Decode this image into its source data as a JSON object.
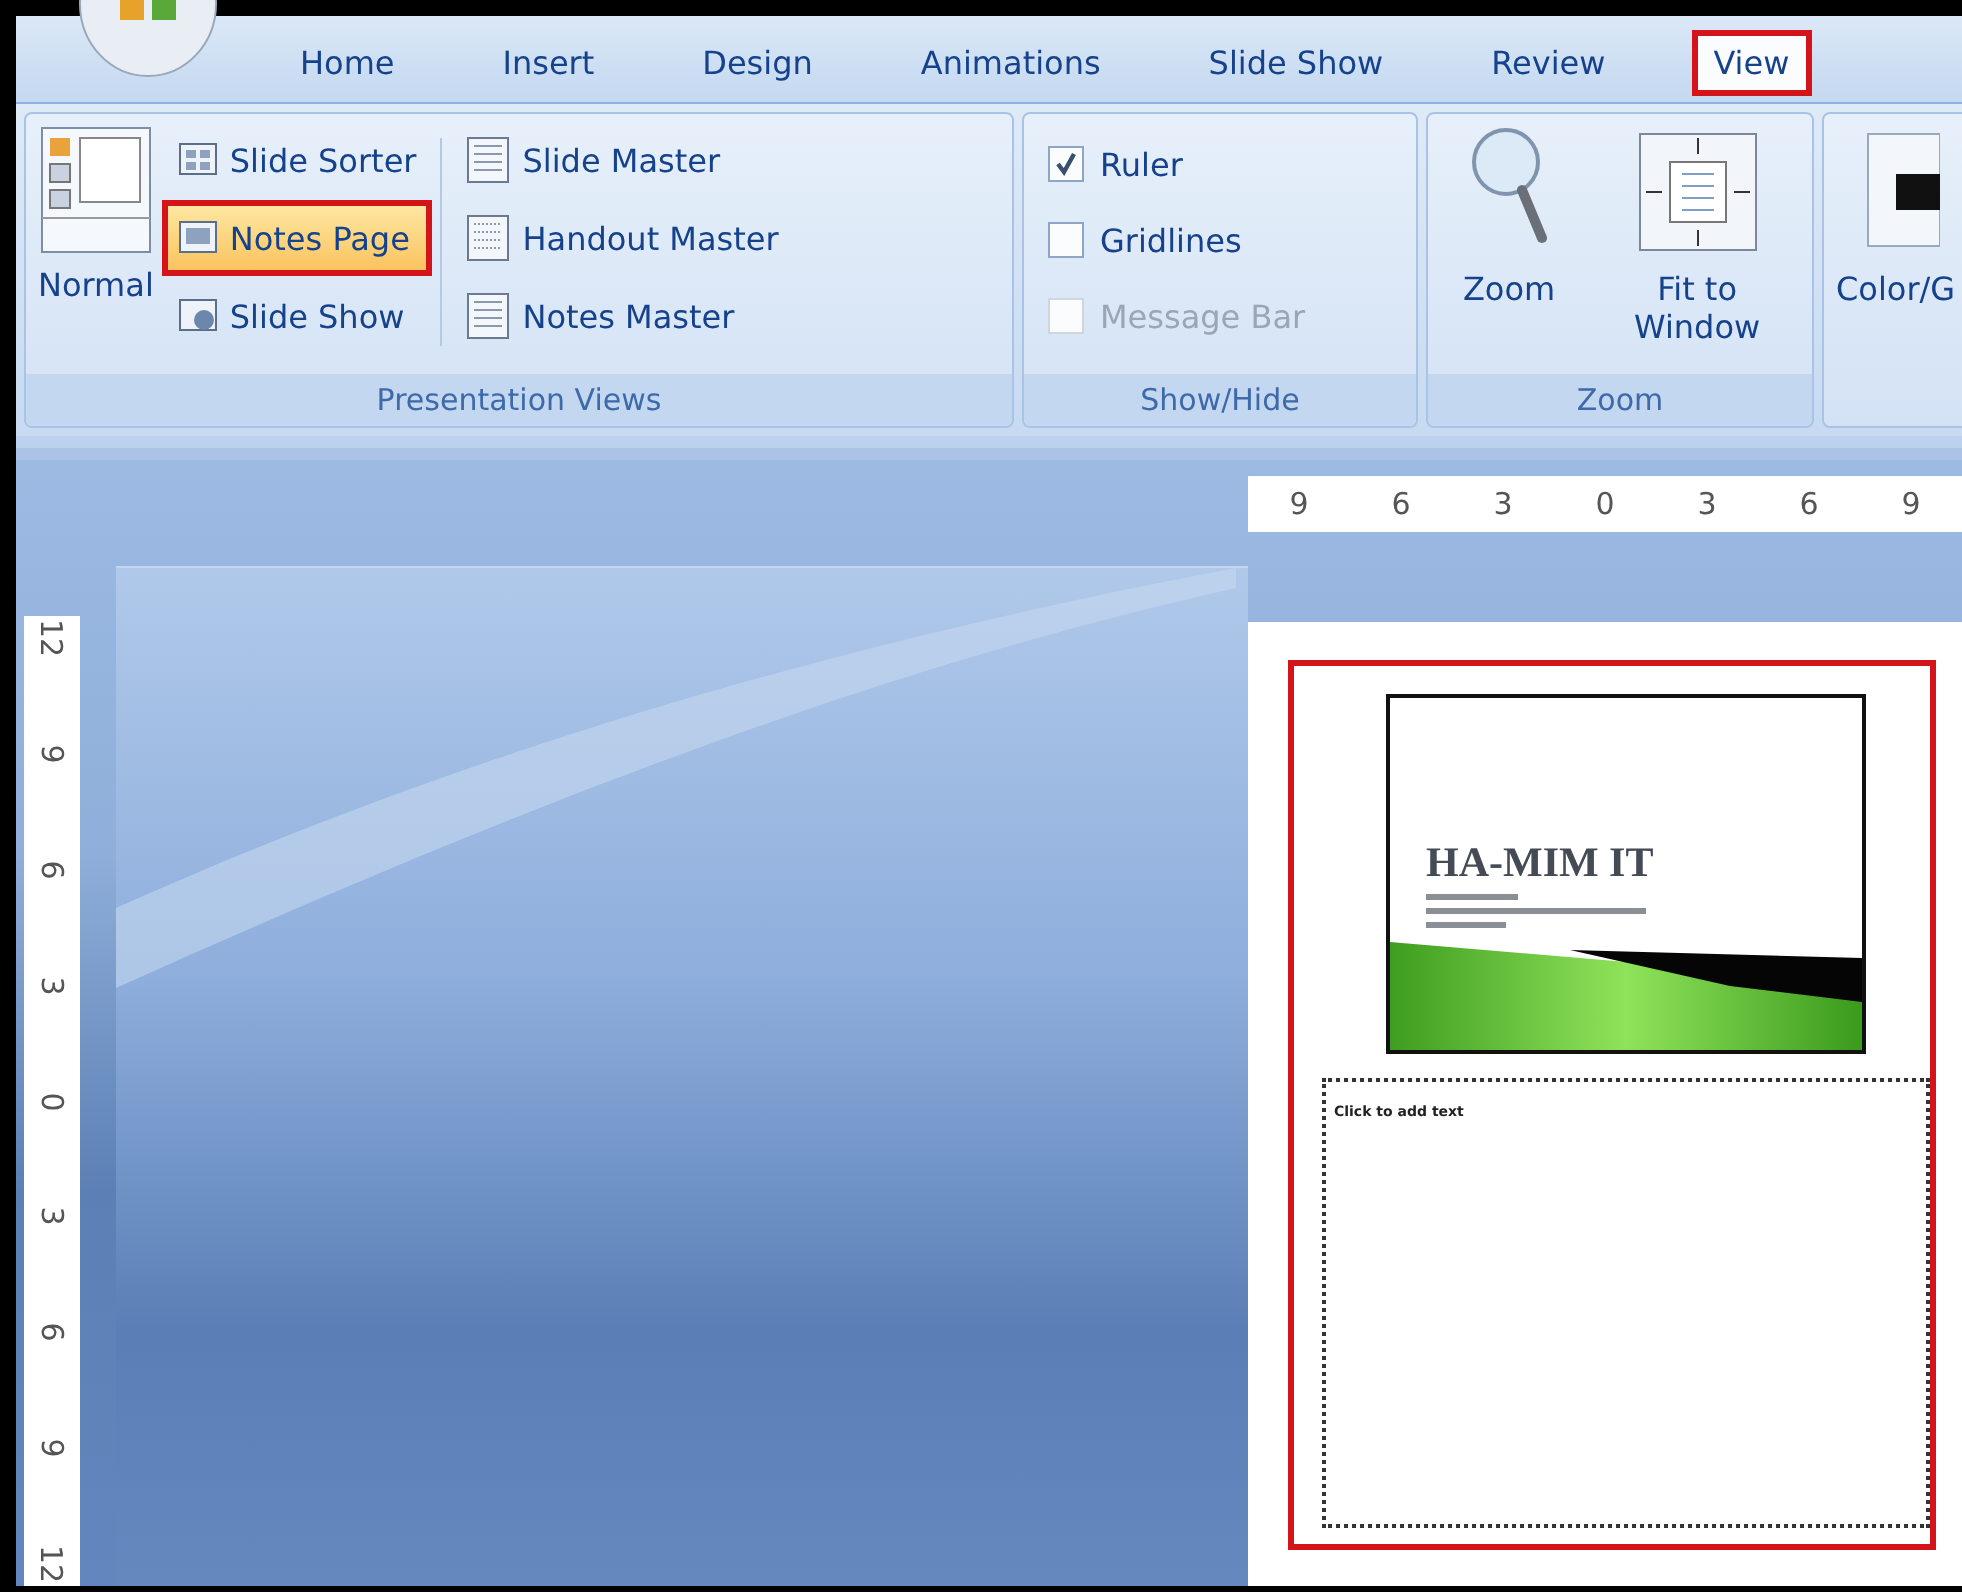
{
  "ribbon_tabs": [
    {
      "label": "Home",
      "selected": false,
      "highlighted": false
    },
    {
      "label": "Insert",
      "selected": false,
      "highlighted": false
    },
    {
      "label": "Design",
      "selected": false,
      "highlighted": false
    },
    {
      "label": "Animations",
      "selected": false,
      "highlighted": false
    },
    {
      "label": "Slide Show",
      "selected": false,
      "highlighted": false
    },
    {
      "label": "Review",
      "selected": false,
      "highlighted": false
    },
    {
      "label": "View",
      "selected": true,
      "highlighted": true
    }
  ],
  "groups": [
    {
      "kind": "views",
      "label": "Presentation Views",
      "normal": "Normal",
      "buttons": [
        {
          "label": "Slide Sorter",
          "selected": false,
          "highlighted": false
        },
        {
          "label": "Notes Page",
          "selected": true,
          "highlighted": true
        },
        {
          "label": "Slide Show",
          "selected": false,
          "highlighted": false
        }
      ],
      "masters": [
        "Slide Master",
        "Handout Master",
        "Notes Master"
      ]
    },
    {
      "kind": "checks",
      "label": "Show/Hide",
      "options": [
        {
          "label": "Ruler",
          "checked": true,
          "disabled": false
        },
        {
          "label": "Gridlines",
          "checked": false,
          "disabled": false
        },
        {
          "label": "Message Bar",
          "checked": false,
          "disabled": true
        }
      ]
    },
    {
      "kind": "zoom",
      "label": "Zoom",
      "buttons": [
        "Zoom",
        "Fit to Window"
      ]
    },
    {
      "kind": "color",
      "buttons": [
        "Color/G"
      ]
    }
  ],
  "horizontal_ruler": [
    "9",
    "6",
    "3",
    "0",
    "3",
    "6",
    "9"
  ],
  "vertical_ruler": [
    "12",
    "9",
    "6",
    "3",
    "0",
    "3",
    "6",
    "9",
    "12"
  ],
  "notes_page": {
    "highlighted": true,
    "slide_title": "HA-MIM IT",
    "notes_placeholder": "Click to add text"
  }
}
